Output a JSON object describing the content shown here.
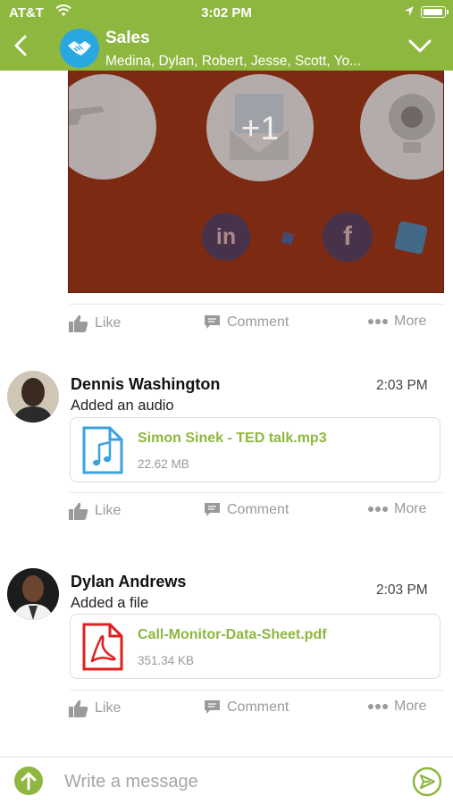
{
  "status_bar": {
    "carrier": "AT&T",
    "time": "3:02 PM"
  },
  "header": {
    "title": "Sales",
    "members": "Medina, Dylan, Robert, Jesse, Scott, Yo..."
  },
  "banner": {
    "overflow_count": "+1"
  },
  "actions": {
    "like": "Like",
    "comment": "Comment",
    "more": "More"
  },
  "posts": [
    {
      "author": "Dennis Washington",
      "time": "2:03 PM",
      "text": "Added an audio",
      "attachment": {
        "name": "Simon Sinek - TED talk.mp3",
        "size": "22.62 MB",
        "icon": "audio-file-icon"
      }
    },
    {
      "author": "Dylan Andrews",
      "time": "2:03 PM",
      "text": "Added a file",
      "attachment": {
        "name": "Call-Monitor-Data-Sheet.pdf",
        "size": "351.34 KB",
        "icon": "pdf-file-icon"
      }
    }
  ],
  "composer": {
    "placeholder": "Write a message"
  },
  "colors": {
    "brand_green": "#8db73f",
    "group_blue": "#29a8e0",
    "banner_bg": "#7d2a13",
    "audio_blue": "#3aa3df",
    "pdf_red": "#e02020"
  }
}
